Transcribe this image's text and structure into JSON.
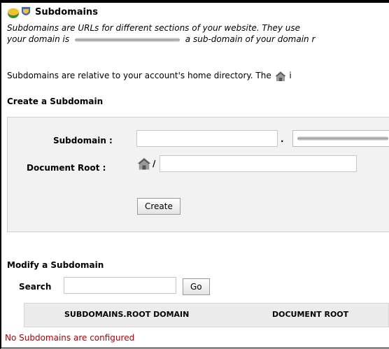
{
  "header": {
    "title": "Subdomains"
  },
  "intro": {
    "line1": "Subdomains are URLs for different sections of your website. They use",
    "line2_prefix": "your domain is",
    "line2_suffix": "a sub-domain of your domain r"
  },
  "relative_note": {
    "prefix": "Subdomains are relative to your account's home directory. The",
    "suffix": "i"
  },
  "create": {
    "section_title": "Create a Subdomain",
    "subdomain_label": "Subdomain :",
    "subdomain_value": "",
    "dot": ".",
    "docroot_label": "Document Root :",
    "docroot_prefix": "/",
    "docroot_value": "",
    "create_button": "Create"
  },
  "modify": {
    "section_title": "Modify a Subdomain",
    "search_label": "Search",
    "search_value": "",
    "go_button": "Go"
  },
  "table": {
    "columns": [
      "Subdomains.Root Domain",
      "Document Root"
    ],
    "empty_message": "No Subdomains are configured"
  },
  "colors": {
    "empty_text": "#b40000",
    "panel_bg": "#f2f2f2"
  },
  "icons": [
    "subdomains-logo-icon",
    "home-icon"
  ]
}
